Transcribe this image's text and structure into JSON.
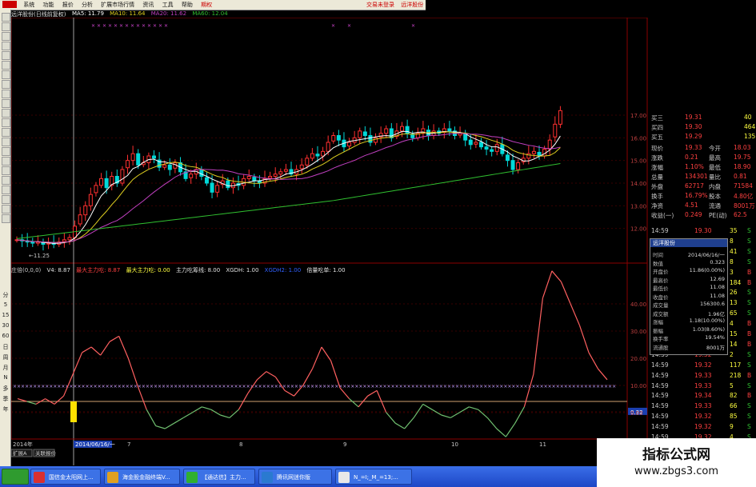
{
  "menubar": {
    "items": [
      "系统",
      "功能",
      "报价",
      "分析",
      "扩展市场行情",
      "资讯",
      "工具",
      "帮助"
    ],
    "highlight": "期权",
    "right": [
      "交易未登录",
      "远洋股份"
    ]
  },
  "left_toolbar": {
    "labels": [
      "分",
      "5",
      "15",
      "30",
      "60",
      "日",
      "周",
      "月",
      "N",
      "多",
      "季",
      "年"
    ]
  },
  "stock": {
    "name": "远洋股份(日线前复权)"
  },
  "ma": {
    "ma5": "MA5: 11.79",
    "ma10": "MA10: 11.64",
    "ma20": "MA20: 11.62",
    "ma60": "MA60: 12.04"
  },
  "indicator": {
    "name": "庄倍(0,0,0)",
    "v4": "V4: 8.87",
    "main_buy": "最大主力吃: 8.87",
    "main_sell": "最大主力吃: 0.00",
    "main_absorb": "主力吃筹线: 8.00",
    "xgdh": "XGDH: 1.00",
    "xgdh2": "XGDH2: 1.00",
    "vol_eat": "倍量吃单: 1.00"
  },
  "price_axis": [
    "17.00",
    "16.00",
    "15.00",
    "14.00",
    "13.00",
    "12.00"
  ],
  "ind_axis": [
    "40.00",
    "30.00",
    "20.00",
    "10.00",
    "0.32",
    "0.00"
  ],
  "chart_data": [
    {
      "type": "candlestick",
      "series_ma": [
        "MA5",
        "MA10",
        "MA20",
        "MA60"
      ],
      "ylim": [
        11,
        17
      ],
      "low_label": "11.25",
      "ylabels": [
        "17.00",
        "16.00",
        "15.00",
        "14.00",
        "13.00",
        "12.00"
      ]
    },
    {
      "type": "line",
      "ylim": [
        -10,
        50
      ],
      "ylabels": [
        "40.00",
        "30.00",
        "20.00",
        "10.00",
        "0.32",
        "0.00"
      ],
      "x": [
        "2014年",
        "2014/06/16/一",
        "7",
        "8",
        "9",
        "10",
        "11"
      ],
      "values": [
        1,
        0,
        -1,
        1,
        -1,
        2,
        10,
        18,
        20,
        17,
        22,
        24,
        16,
        6,
        -3,
        -9,
        -10,
        -8,
        -6,
        -4,
        -2,
        -3,
        -5,
        -6,
        -3,
        3,
        8,
        11,
        9,
        4,
        2,
        6,
        12,
        20,
        15,
        5,
        1,
        -2,
        2,
        4,
        -4,
        -8,
        -10,
        -6,
        -1,
        -3,
        -5,
        -6,
        -4,
        -2,
        -3,
        -6,
        -10,
        -13,
        -8,
        -2,
        10,
        38,
        48,
        44,
        36,
        28,
        18,
        12,
        8
      ]
    }
  ],
  "quote_panel": {
    "orders": [
      {
        "label": "买三",
        "price": "19.31",
        "vol": "40"
      },
      {
        "label": "买四",
        "price": "19.30",
        "vol": "464"
      },
      {
        "label": "买五",
        "price": "19.29",
        "vol": "135"
      }
    ],
    "stats": [
      {
        "l1": "现价",
        "v1": "19.33",
        "l2": "今开",
        "v2": "18.03"
      },
      {
        "l1": "涨跌",
        "v1": "0.21",
        "l2": "最高",
        "v2": "19.75"
      },
      {
        "l1": "涨幅",
        "v1": "1.10%",
        "l2": "最低",
        "v2": "18.90"
      },
      {
        "l1": "总量",
        "v1": "134301",
        "l2": "量比",
        "v2": "0.81"
      },
      {
        "l1": "外盘",
        "v1": "62717",
        "l2": "内盘",
        "v2": "71584"
      },
      {
        "l1": "换手",
        "v1": "16.79%",
        "l2": "股本",
        "v2": "4.80亿"
      },
      {
        "l1": "净资",
        "v1": "4.51",
        "l2": "流通",
        "v2": "8001万"
      },
      {
        "l1": "收益(一)",
        "v1": "0.249",
        "l2": "PE(动)",
        "v2": "62.5"
      }
    ],
    "ticks": [
      {
        "t": "14:59",
        "p": "19.30",
        "v": "35",
        "d": "S"
      },
      {
        "t": "14:59",
        "p": "19.30",
        "v": "8",
        "d": "S"
      },
      {
        "t": "14:59",
        "p": "19.31",
        "v": "41",
        "d": "S"
      },
      {
        "t": "14:59",
        "p": "19.31",
        "v": "8",
        "d": "S"
      },
      {
        "t": "14:59",
        "p": "19.33",
        "v": "3",
        "d": "B"
      },
      {
        "t": "14:59",
        "p": "19.33",
        "v": "184",
        "d": "B"
      },
      {
        "t": "14:59",
        "p": "19.32",
        "v": "26",
        "d": "S"
      },
      {
        "t": "14:59",
        "p": "19.32",
        "v": "13",
        "d": "S"
      },
      {
        "t": "14:59",
        "p": "19.32",
        "v": "65",
        "d": "S"
      },
      {
        "t": "14:59",
        "p": "19.32",
        "v": "4",
        "d": "B"
      },
      {
        "t": "14:59",
        "p": "19.33",
        "v": "15",
        "d": "B"
      },
      {
        "t": "14:59",
        "p": "19.33",
        "v": "14",
        "d": "B"
      },
      {
        "t": "14:59",
        "p": "19.32",
        "v": "2",
        "d": "S"
      },
      {
        "t": "14:59",
        "p": "19.32",
        "v": "117",
        "d": "S"
      },
      {
        "t": "14:59",
        "p": "19.33",
        "v": "218",
        "d": "B"
      },
      {
        "t": "14:59",
        "p": "19.33",
        "v": "5",
        "d": "S"
      },
      {
        "t": "14:59",
        "p": "19.34",
        "v": "82",
        "d": "B"
      },
      {
        "t": "14:59",
        "p": "19.33",
        "v": "66",
        "d": "S"
      },
      {
        "t": "14:59",
        "p": "19.32",
        "v": "85",
        "d": "S"
      },
      {
        "t": "14:59",
        "p": "19.32",
        "v": "9",
        "d": "S"
      },
      {
        "t": "14:59",
        "p": "19.32",
        "v": "4",
        "d": "S"
      }
    ]
  },
  "popup": {
    "title": "远洋股份",
    "rows": [
      {
        "l": "时间",
        "v": "2014/06/16/一"
      },
      {
        "l": "数值",
        "v": "0.323"
      },
      {
        "l": "开盘价",
        "v": "11.86(0.00%)"
      },
      {
        "l": "最高价",
        "v": "12.69"
      },
      {
        "l": "最低价",
        "v": "11.08"
      },
      {
        "l": "收盘价",
        "v": "11.08"
      },
      {
        "l": "成交量",
        "v": "156300.6"
      },
      {
        "l": "成交额",
        "v": "1.96亿"
      },
      {
        "l": "涨幅",
        "v": "1.18(10.00%)"
      },
      {
        "l": "振幅",
        "v": "1.03(8.60%)"
      },
      {
        "l": "换手率",
        "v": "19.54%"
      },
      {
        "l": "流通股",
        "v": "8001万"
      }
    ]
  },
  "bottom": {
    "tabs": [
      "扩展A",
      "关联报价"
    ],
    "date_start": "2014年",
    "date_cursor": "2014/06/16/一",
    "months": [
      "7",
      "8",
      "9",
      "10",
      "11"
    ]
  },
  "taskbar": {
    "items": [
      "国信金太阳网上...",
      "海金股金融终端V...",
      "【通达信】主力...",
      "腾讯网迷你版",
      "N_=I;_M_=13;..."
    ]
  },
  "watermark": {
    "line1": "指标公式网",
    "line2": "www.zbgs3.com"
  },
  "colors": {
    "up": "#ff3030",
    "down": "#00d8d8",
    "ma5": "#ffffff",
    "ma10": "#e0d020",
    "ma20": "#c040c0",
    "ma60": "#30c030",
    "grid": "#8b0000"
  }
}
